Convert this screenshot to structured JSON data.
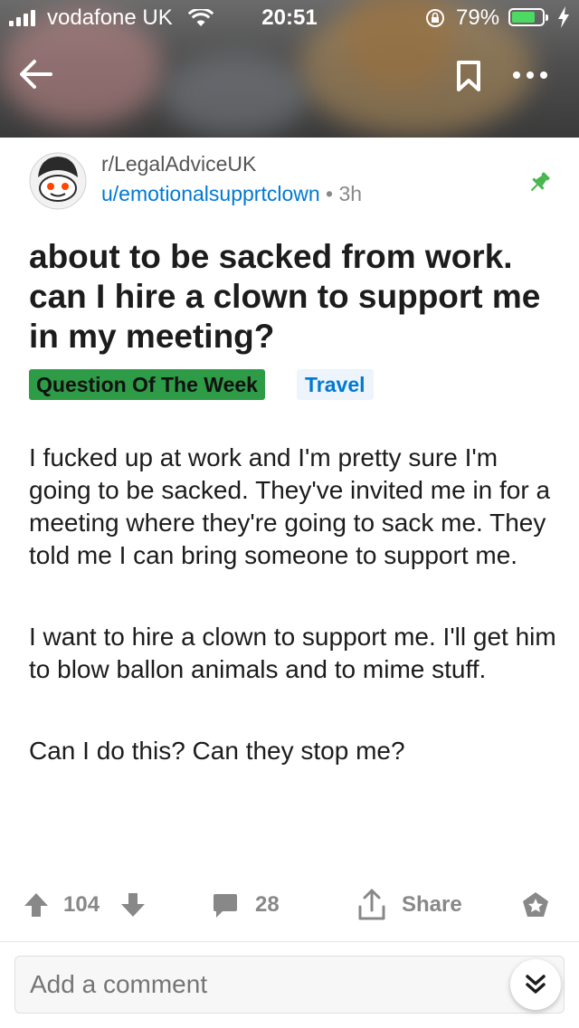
{
  "status_bar": {
    "carrier": "vodafone UK",
    "time": "20:51",
    "battery_percent": "79%",
    "battery_level": 0.79
  },
  "toolbar": {
    "back_icon": "arrow-left-icon",
    "bookmark_icon": "bookmark-icon",
    "more_icon": "more-dots-icon"
  },
  "post": {
    "subreddit": "r/LegalAdviceUK",
    "author": "u/emotionalsupprtclown",
    "separator": "•",
    "age": "3h",
    "pinned": true,
    "title": "about to be sacked from work. can I hire a clown to support me in my meeting?",
    "flairs": [
      "Question Of The Week",
      "Travel"
    ],
    "paragraphs": [
      "I fucked up at work and I'm pretty sure I'm going to be sacked. They've invited me in for a meeting where they're going to sack me. They told me I can bring someone to support me.",
      "I want to hire a clown to support me. I'll get him to blow ballon animals and to mime stuff.",
      "Can I do this? Can they stop me?"
    ]
  },
  "actions": {
    "score": "104",
    "comments": "28",
    "share_label": "Share"
  },
  "comment_box": {
    "placeholder": "Add a comment"
  },
  "colors": {
    "link_blue": "#0079d3",
    "flair_green": "#2e9b47",
    "pin_green": "#46b64d",
    "battery_green": "#4cd964",
    "muted_text": "#888888"
  }
}
